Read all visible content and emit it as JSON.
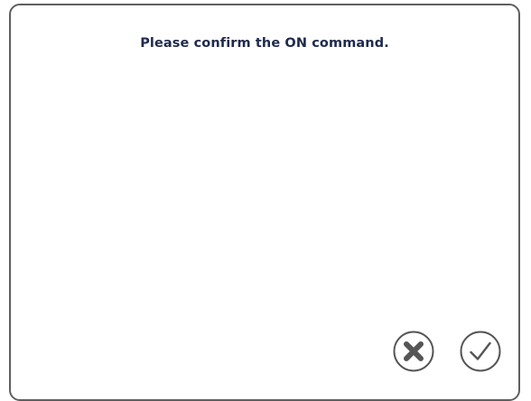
{
  "dialog": {
    "message": "Please confirm the ON command."
  },
  "buttons": {
    "cancel_icon": "x-circle-icon",
    "confirm_icon": "check-circle-icon"
  },
  "colors": {
    "message_text": "#1f2a4d",
    "border": "#5f5f5f",
    "icon": "#555555"
  }
}
